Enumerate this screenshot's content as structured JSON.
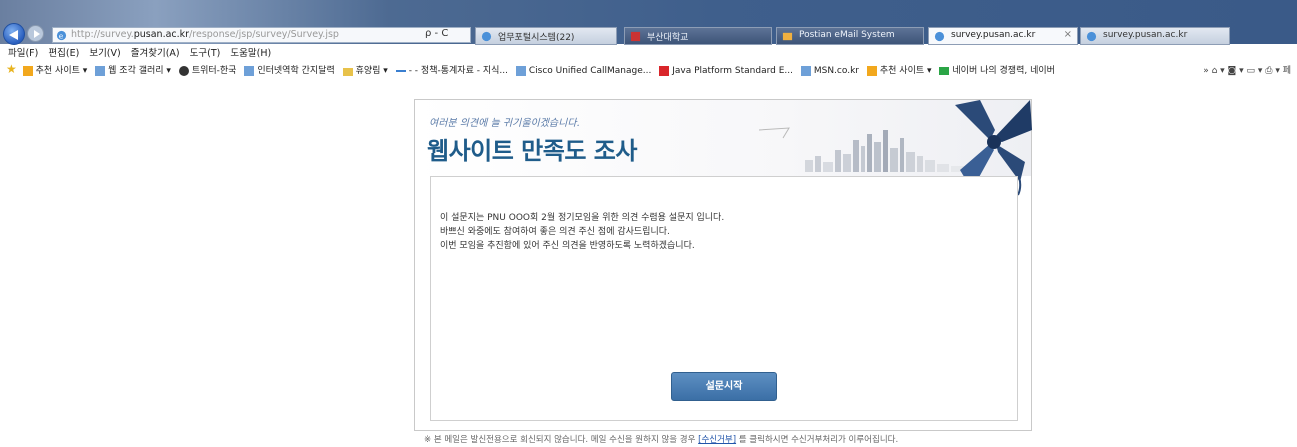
{
  "browser": {
    "address": {
      "prefix": "http://survey.",
      "host": "pusan.ac.kr",
      "path": "/response/jsp/survey/Survey.jsp",
      "tools": "ρ - C"
    },
    "tabs": [
      {
        "label": "업무포털시스템(22)"
      },
      {
        "label": "부산대학교"
      },
      {
        "label": "Postian eMail System"
      },
      {
        "label": "survey.pusan.ac.kr",
        "close": "×"
      },
      {
        "label": "survey.pusan.ac.kr"
      }
    ],
    "menu": [
      "파일(F)",
      "편집(E)",
      "보기(V)",
      "즐겨찾기(A)",
      "도구(T)",
      "도움말(H)"
    ],
    "favorites": [
      "추천 사이트 ▾",
      "웹 조각 갤러리 ▾",
      "트위터-한국",
      "인터넷역학 간지달력",
      "휴양림 ▾",
      "- - 정책-통계자료 - 지식...",
      "Cisco Unified CallManage...",
      "Java Platform Standard E...",
      "MSN.co.kr",
      "추천 사이트 ▾",
      "네이버 나의 경쟁력, 네이버"
    ],
    "fav_right": "»  ⌂ ▾  ◙ ▾  ▭ ▾  ⎙ ▾  페"
  },
  "survey": {
    "tagline": "여러분 의견에 늘 귀기울이겠습니다.",
    "title": "웹사이트 만족도 조사",
    "intro": [
      "이 설문지는 PNU OOO회 2월 정기모임을 위한 의견 수렴용 설문지 입니다.",
      "바쁘신 와중에도 참여하여 좋은 의견 주신 점에 감사드립니다.",
      "이번 모임을 추진함에 있어 주신 의견을 반영하도록 노력하겠습니다."
    ],
    "start_label": "설문시작"
  },
  "footer": {
    "before": "※ 본 메일은 발신전용으로 회신되지 않습니다. 메일 수신을 원하지 않을 경우 ",
    "link": "[수신거부]",
    "after": " 를 클릭하시면 수신거부처리가 이루어집니다."
  },
  "colors": {
    "title": "#1f5c8a",
    "button": "#3b6fa6",
    "ribbon": "#2b4a78"
  }
}
